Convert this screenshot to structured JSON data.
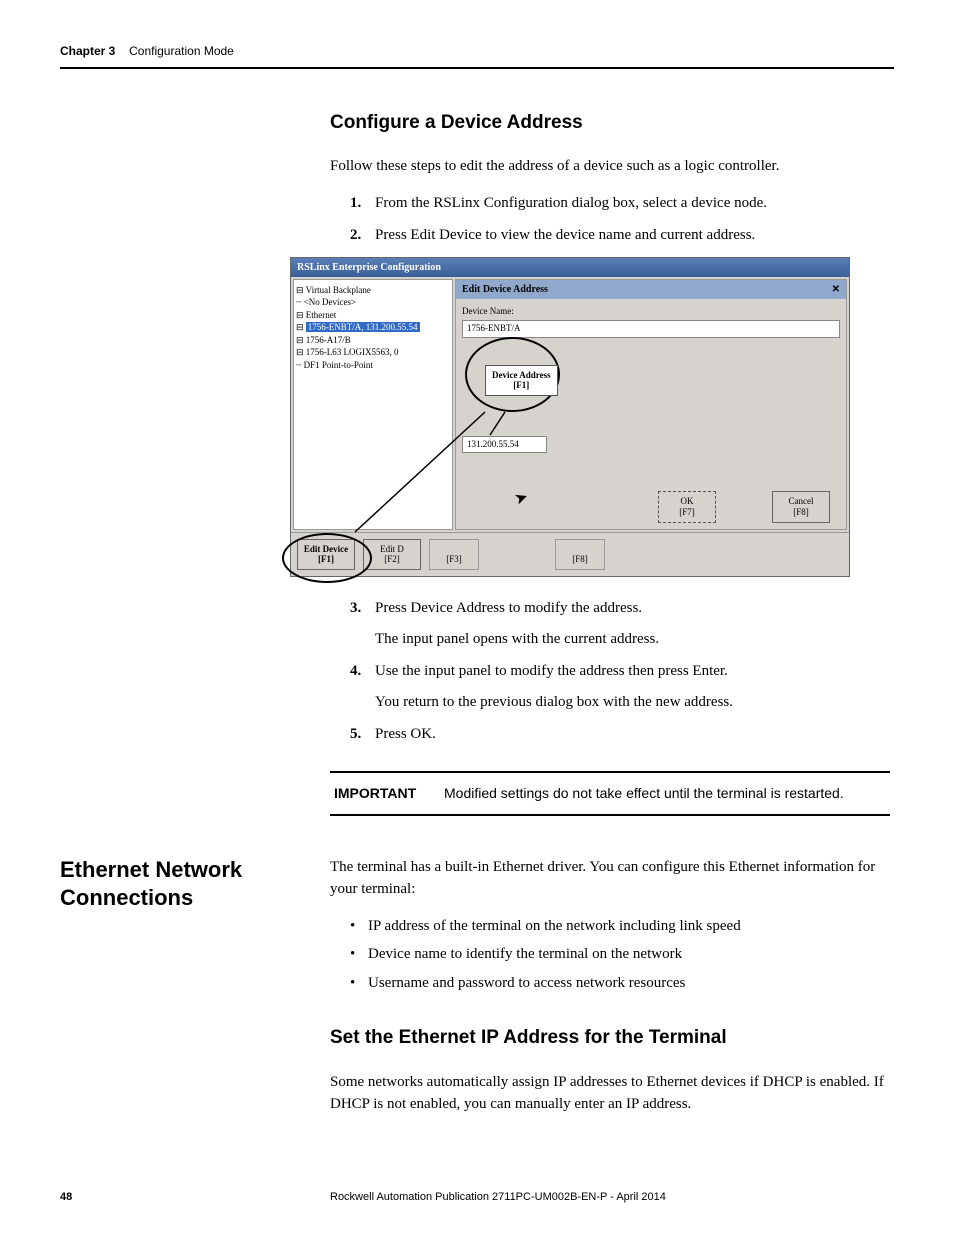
{
  "header": {
    "chapter": "Chapter 3",
    "title": "Configuration Mode"
  },
  "sec1": {
    "heading": "Configure a Device Address",
    "intro": "Follow these steps to edit the address of a device such as a logic controller.",
    "step1": "From the RSLinx Configuration dialog box, select a device node.",
    "step2": "Press Edit Device to view the device name and current address.",
    "step3": "Press Device Address to modify the address.",
    "step3b": "The input panel opens with the current address.",
    "step4": "Use the input panel to modify the address then press Enter.",
    "step4b": "You return to the previous dialog box with the new address.",
    "step5": "Press OK."
  },
  "shot": {
    "title": "RSLinx Enterprise Configuration",
    "tree": {
      "l1": "⊟ Virtual Backplane",
      "l2": "    ┈ <No Devices>",
      "l3": "⊟ Ethernet",
      "l4": "1756-ENBT/A, 131.200.55.54",
      "l5": "      ⊟ 1756-A17/B",
      "l6": "         ⊟ 1756-L63 LOGIX5563, 0",
      "l7": "    ┈ DF1 Point-to-Point"
    },
    "panel_title": "Edit Device Address",
    "dev_name_lbl": "Device Name:",
    "dev_name_val": "1756-ENBT/A",
    "addr_val": "131.200.55.54",
    "callout": "Device Address\n[F1]",
    "ok": "OK\n[F7]",
    "cancel": "Cancel\n[F8]",
    "edit_device": "Edit Device\n[F1]",
    "edit_d": "Edit D\n[F2]",
    "f3": "[F3]",
    "f8": "[F8]"
  },
  "important": {
    "label": "IMPORTANT",
    "msg": "Modified settings do not take effect until the terminal is restarted."
  },
  "sec2": {
    "sidehead": "Ethernet Network Connections",
    "p1": "The terminal has a built-in Ethernet driver. You can configure this Ethernet information for your terminal:",
    "b1": "IP address of the terminal on the network including link speed",
    "b2": "Device name to identify the terminal on the network",
    "b3": "Username and password to access network resources",
    "sub": "Set the Ethernet IP Address for the Terminal",
    "p2": "Some networks automatically assign IP addresses to Ethernet devices if DHCP is enabled. If DHCP is not enabled, you can manually enter an IP address."
  },
  "footer": {
    "page": "48",
    "pub": "Rockwell Automation Publication 2711PC-UM002B-EN-P - April 2014"
  },
  "nums": {
    "n1": "1.",
    "n2": "2.",
    "n3": "3.",
    "n4": "4.",
    "n5": "5."
  }
}
